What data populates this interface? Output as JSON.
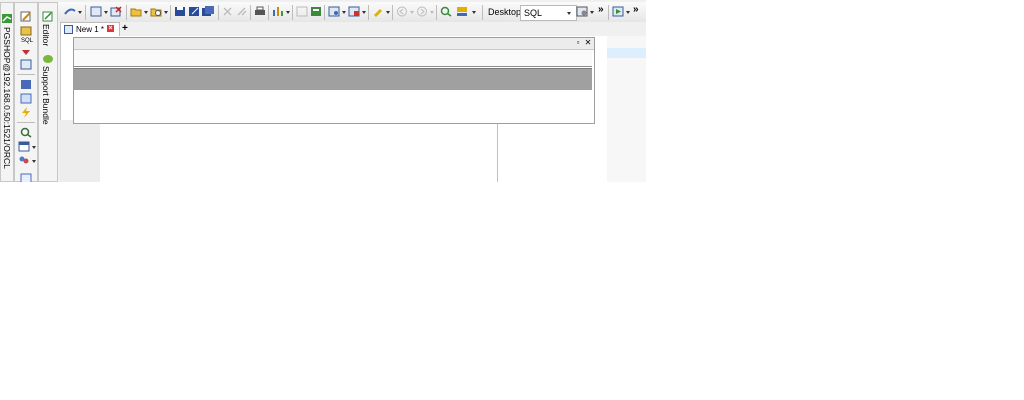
{
  "connection": {
    "label": "PGSHOP@192.168.0.50:1521/ORCL"
  },
  "side_panels": {
    "editor_label": "Editor",
    "support_label": "Support Bundle"
  },
  "toolbar": {
    "desktop_label": "Desktop:",
    "desktop_value": "SQL",
    "sql_icon_text": "SQL"
  },
  "tabs": [
    {
      "label": "New 1 *"
    }
  ],
  "tab_add_label": "+",
  "colors": {
    "window_bg": "#f0f0f0",
    "panel_gray": "#a0a0a0",
    "tab_close": "#d93a3a",
    "highlight": "#ddefff"
  }
}
